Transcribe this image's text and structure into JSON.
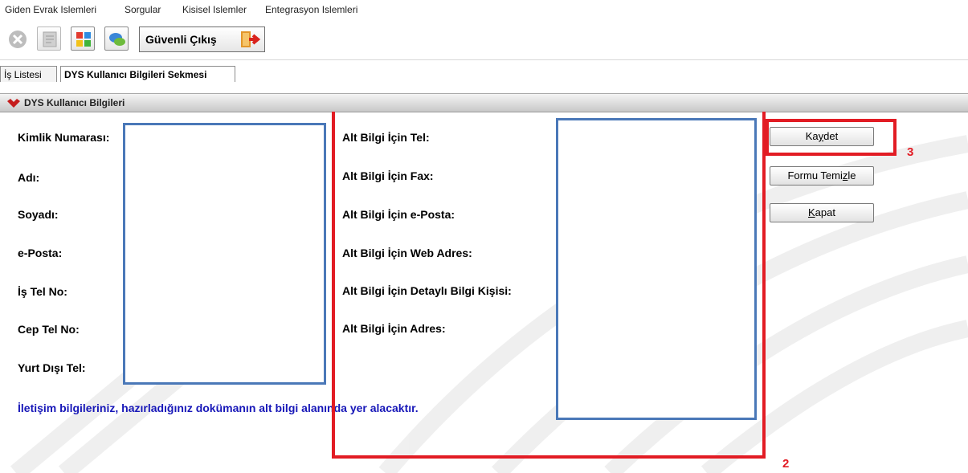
{
  "menu": {
    "items": [
      {
        "label": "Giden Evrak Islemleri"
      },
      {
        "label": "Sorgular"
      },
      {
        "label": "Kisisel Islemler"
      },
      {
        "label": "Entegrasyon Islemleri"
      }
    ]
  },
  "toolbar": {
    "safe_exit_label": "Güvenli Çıkış",
    "icons": [
      "stop-icon",
      "document-icon",
      "color-grid-icon",
      "chat-icon",
      "exit-door-icon"
    ]
  },
  "tabs": [
    {
      "label": "İş Listesi",
      "active": false
    },
    {
      "label": "DYS Kullanıcı Bilgileri Sekmesi",
      "active": true
    }
  ],
  "panel": {
    "title": "DYS Kullanıcı Bilgileri"
  },
  "form": {
    "left_labels": [
      "Kimlik Numarası:",
      "Adı:",
      "Soyadı:",
      "e-Posta:",
      "İş Tel No:",
      "Cep Tel No:",
      "Yurt Dışı Tel:"
    ],
    "right_labels": [
      "Alt Bilgi İçin Tel:",
      "Alt Bilgi İçin Fax:",
      "Alt Bilgi İçin e-Posta:",
      "Alt Bilgi İçin Web Adres:",
      "Alt Bilgi İçin Detaylı Bilgi Kişisi:",
      "Alt Bilgi İçin Adres:"
    ],
    "notice": "İletişim bilgileriniz, hazırladığınız dokümanın alt bilgi alanında yer alacaktır."
  },
  "buttons": {
    "save": {
      "pre": "Ka",
      "mnemonic": "y",
      "post": "det"
    },
    "clear": {
      "pre": "Formu Temi",
      "mnemonic": "z",
      "post": "le"
    },
    "close": {
      "pre": "",
      "mnemonic": "K",
      "post": "apat"
    }
  },
  "annotations": {
    "box2_number": "2",
    "box3_number": "3"
  },
  "colors": {
    "annotation_red": "#e21c24",
    "field_border_blue": "#4a78b8",
    "notice_blue": "#1717b8"
  }
}
